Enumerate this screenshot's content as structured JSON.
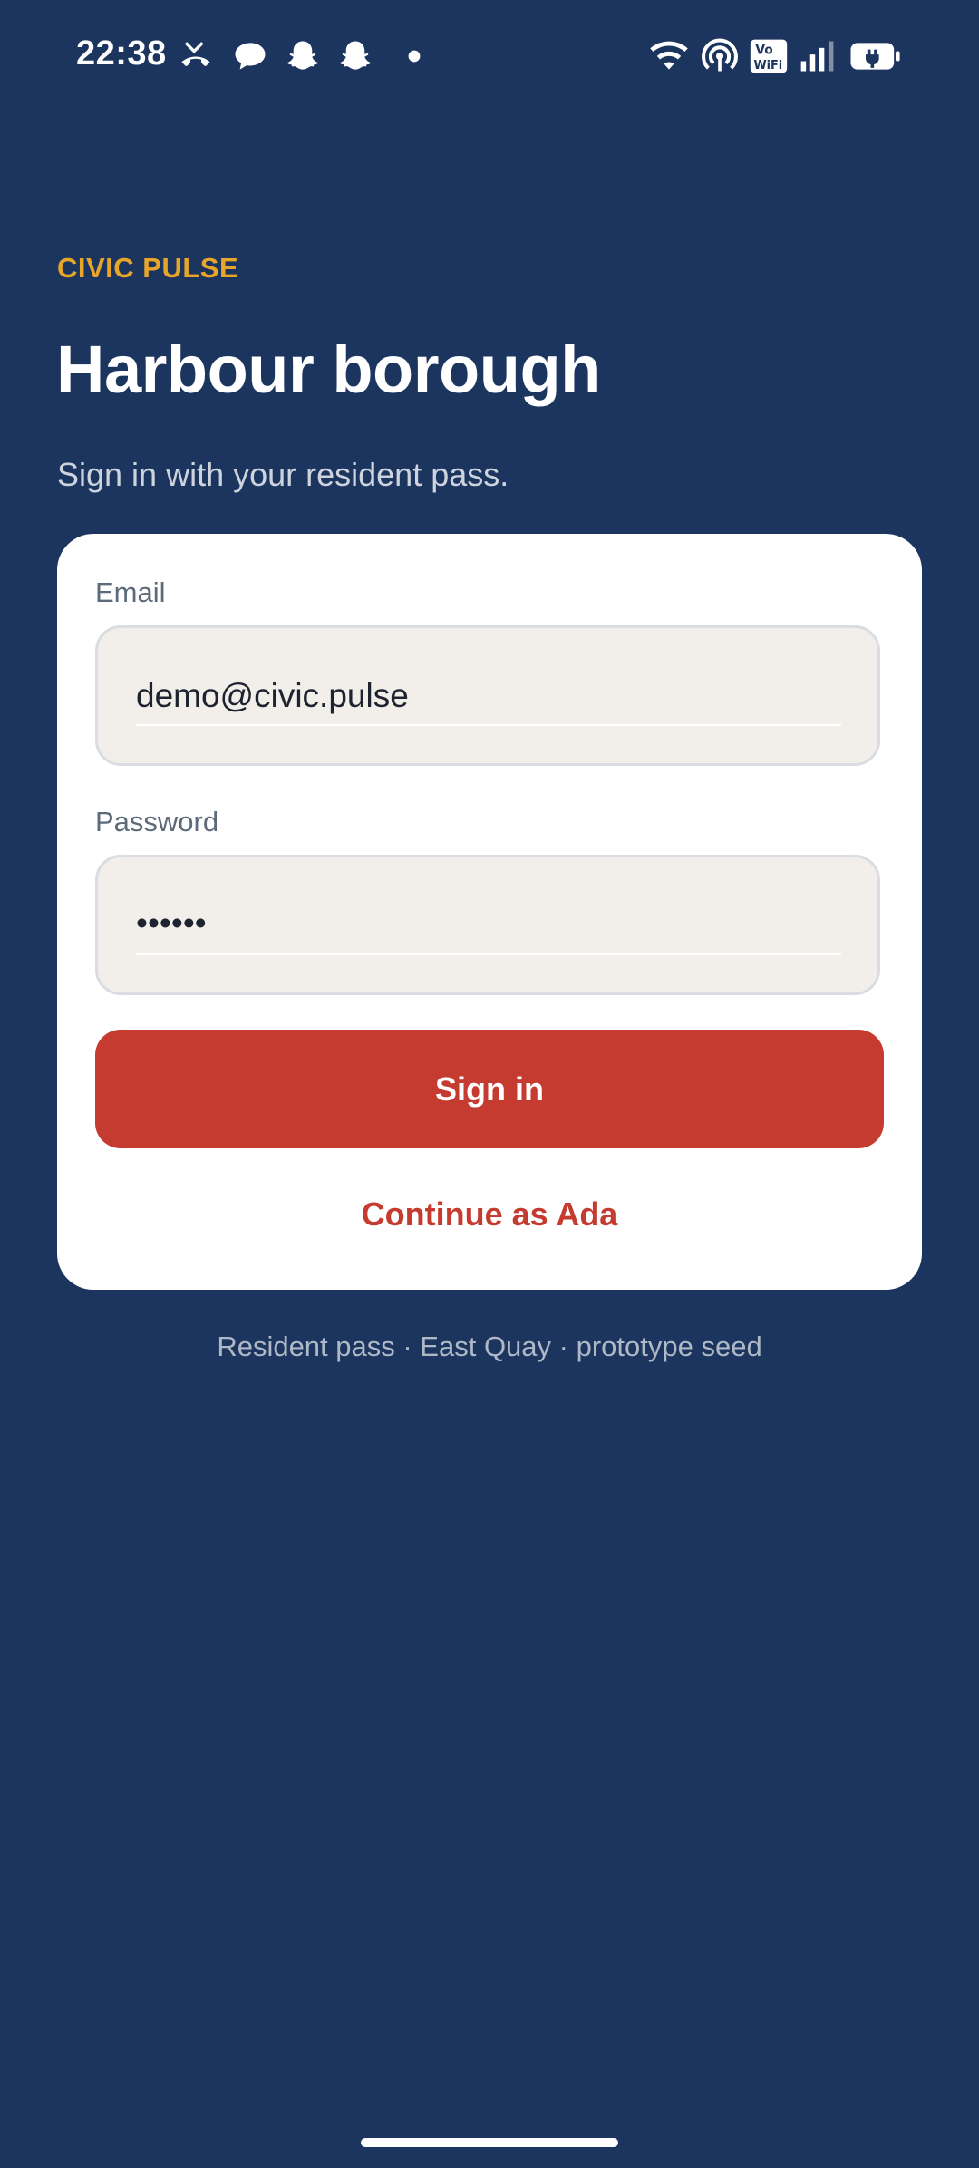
{
  "status_bar": {
    "time": "22:38",
    "left_icons": [
      "missed-call-icon",
      "chat-bubble-icon",
      "snapchat-ghost-icon",
      "snapchat-ghost-icon",
      "dot-icon"
    ],
    "right_icons": [
      "wifi-icon",
      "hotspot-icon",
      "vowifi-icon",
      "signal-icon",
      "battery-charging-icon"
    ],
    "vowifi_text": "Vo WiFi"
  },
  "header": {
    "brand": "CIVIC PULSE",
    "title": "Harbour borough",
    "subtitle": "Sign in with your resident pass."
  },
  "form": {
    "email_label": "Email",
    "email_value": "demo@civic.pulse",
    "password_label": "Password",
    "password_value": "••••••",
    "sign_in_label": "Sign in",
    "continue_label": "Continue as Ada"
  },
  "footer": {
    "note": "Resident pass · East Quay · prototype seed"
  },
  "colors": {
    "background": "#1c355e",
    "brand": "#e7a52a",
    "accent": "#c63b2f",
    "card": "#ffffff",
    "field_bg": "#f2efea"
  }
}
